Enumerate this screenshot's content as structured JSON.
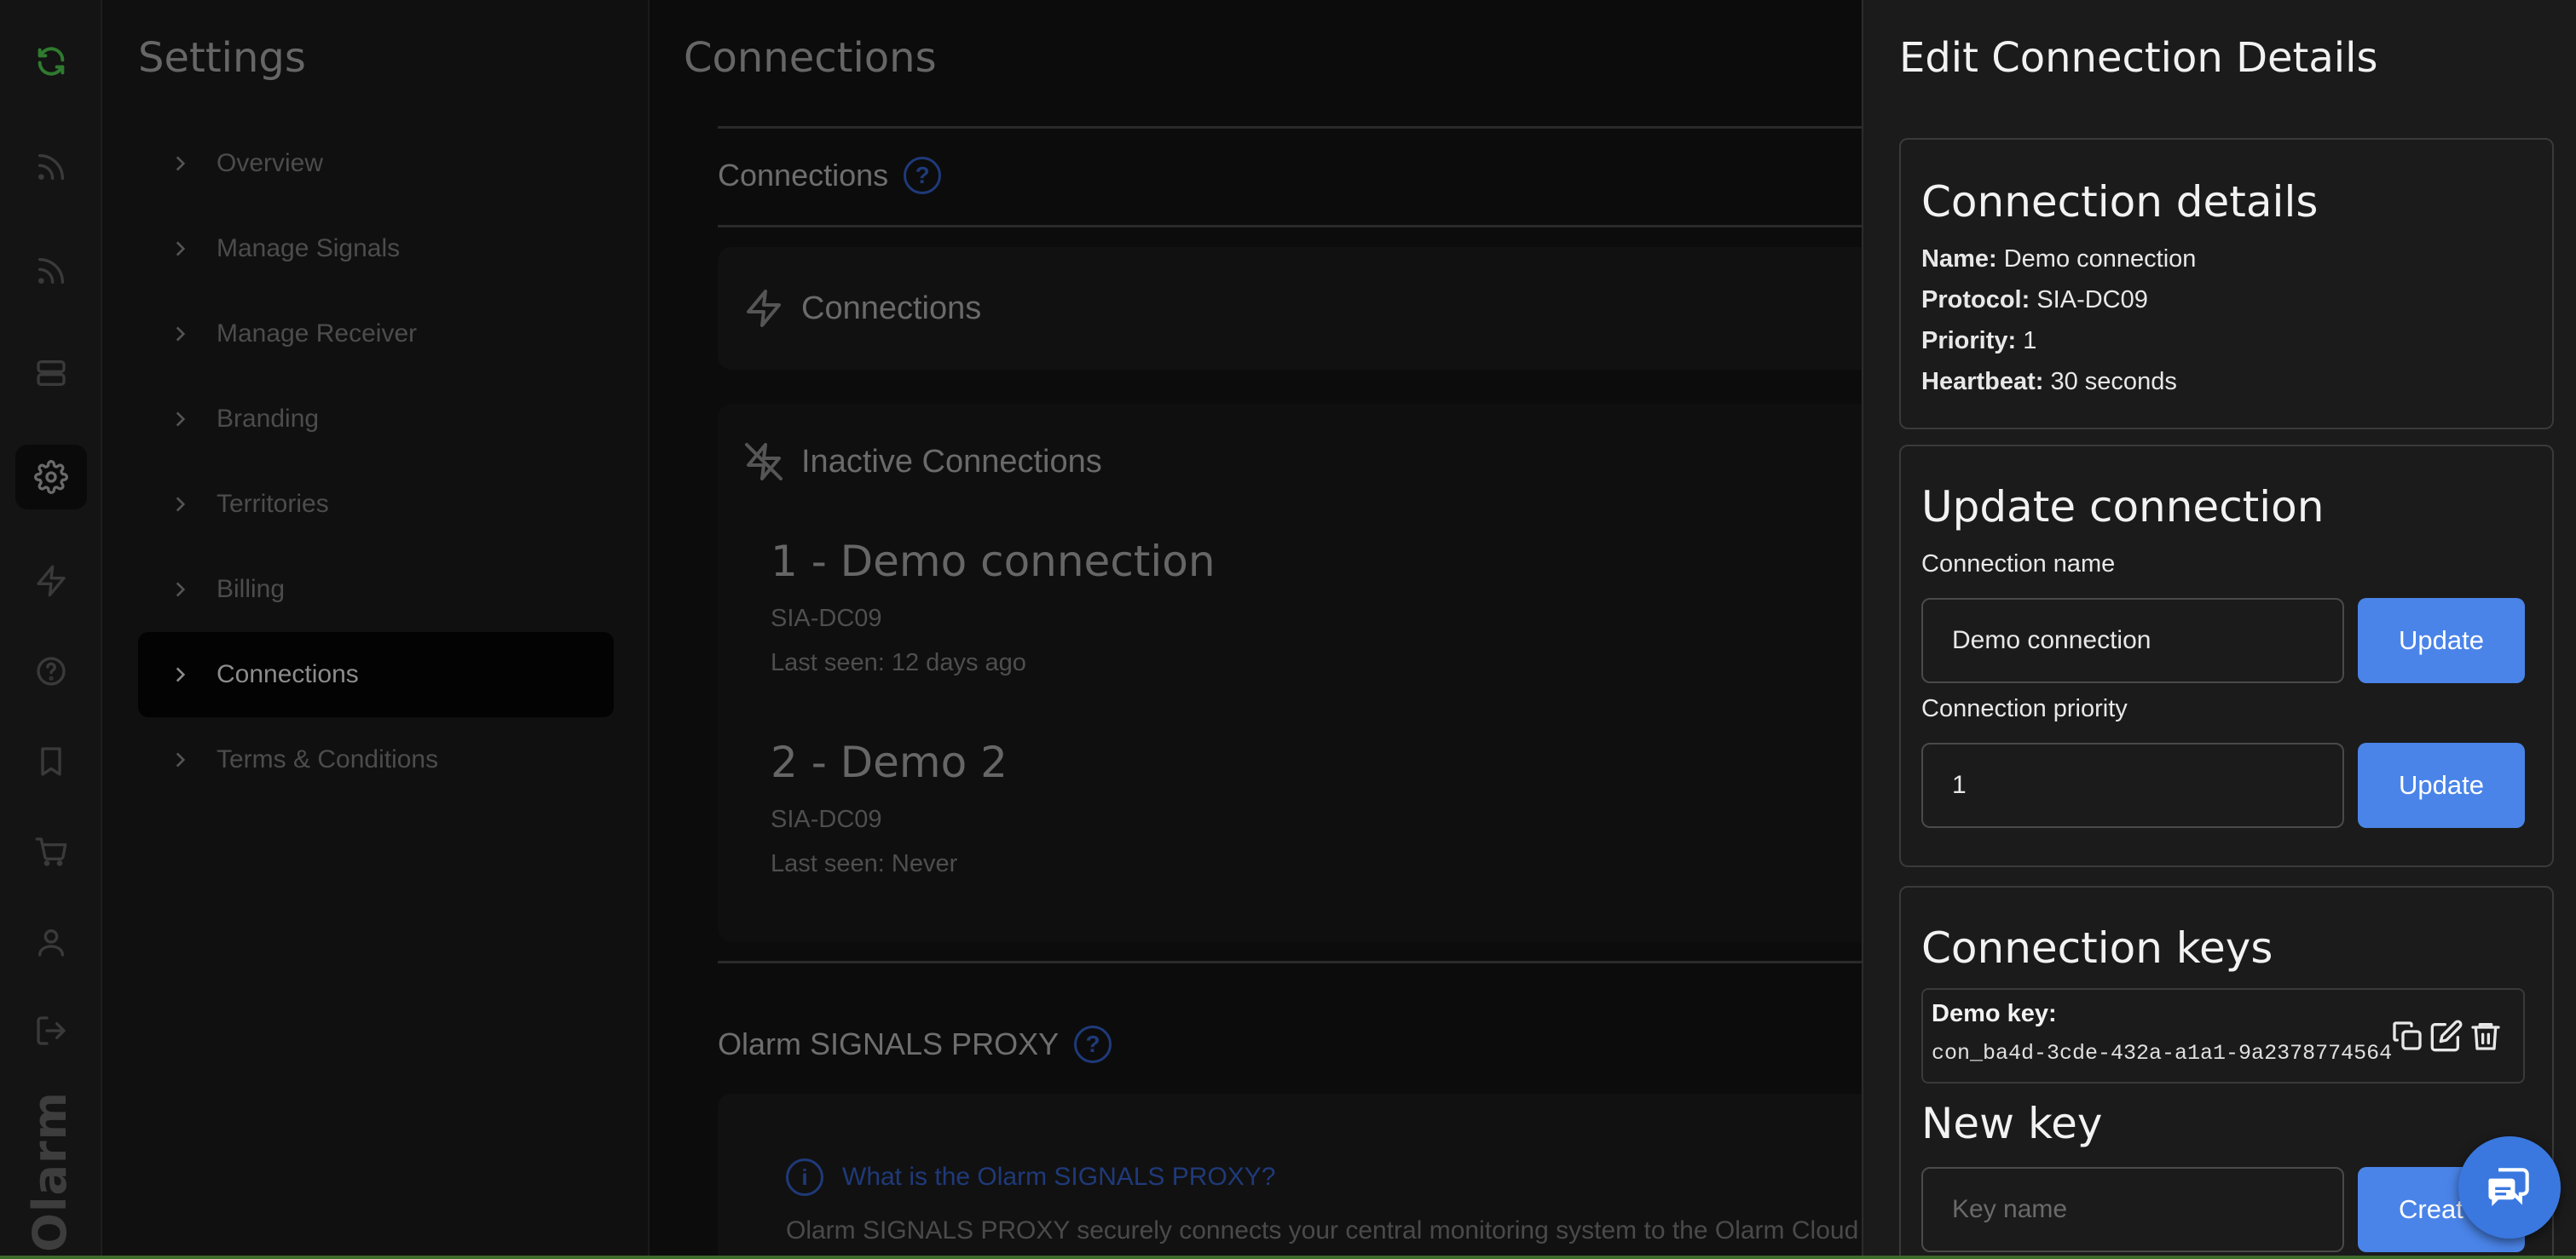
{
  "rail": {
    "icons": [
      "refresh-icon",
      "signal-icon",
      "signal-alt-icon",
      "server-icon",
      "settings-gear-icon",
      "lightning-icon",
      "help-circle-icon",
      "bookmark-icon",
      "cart-icon",
      "user-icon",
      "logout-icon"
    ],
    "brand": "Olarm"
  },
  "settings": {
    "title": "Settings",
    "menu": [
      {
        "label": "Overview"
      },
      {
        "label": "Manage Signals"
      },
      {
        "label": "Manage Receiver"
      },
      {
        "label": "Branding"
      },
      {
        "label": "Territories"
      },
      {
        "label": "Billing"
      },
      {
        "label": "Connections",
        "active": true
      },
      {
        "label": "Terms & Conditions"
      }
    ]
  },
  "main": {
    "title": "Connections",
    "section_heading": "Connections",
    "connections_card_title": "Connections",
    "inactive_card_title": "Inactive Connections",
    "inactive_connections": [
      {
        "title": "1 - Demo connection",
        "protocol": "SIA-DC09",
        "last_seen": "Last seen: 12 days ago"
      },
      {
        "title": "2 - Demo 2",
        "protocol": "SIA-DC09",
        "last_seen": "Last seen: Never"
      }
    ],
    "proxy_heading": "Olarm SIGNALS PROXY",
    "proxy_question": "What is the Olarm SIGNALS PROXY?",
    "proxy_text": "Olarm SIGNALS PROXY securely connects your central monitoring system to the Olarm Cloud"
  },
  "panel": {
    "title": "Edit Connection Details",
    "details": {
      "heading": "Connection details",
      "name_label": "Name:",
      "name_value": " Demo connection",
      "protocol_label": "Protocol:",
      "protocol_value": " SIA-DC09",
      "priority_label": "Priority:",
      "priority_value": " 1",
      "heartbeat_label": "Heartbeat:",
      "heartbeat_value": " 30 seconds"
    },
    "update": {
      "heading": "Update connection",
      "name_label": "Connection name",
      "name_value": "Demo connection",
      "priority_label": "Connection priority",
      "priority_value": "1",
      "button_label": "Update"
    },
    "keys": {
      "heading": "Connection keys",
      "key_name": "Demo key:",
      "key_value": "con_ba4d-3cde-432a-a1a1-9a2378774564",
      "new_key_heading": "New key",
      "new_key_placeholder": "Key name",
      "create_label": "Creat"
    }
  },
  "colors": {
    "accent": "#4a84e8",
    "brand_green": "#2f7a2f",
    "panel_bg": "#1b1b1b"
  }
}
